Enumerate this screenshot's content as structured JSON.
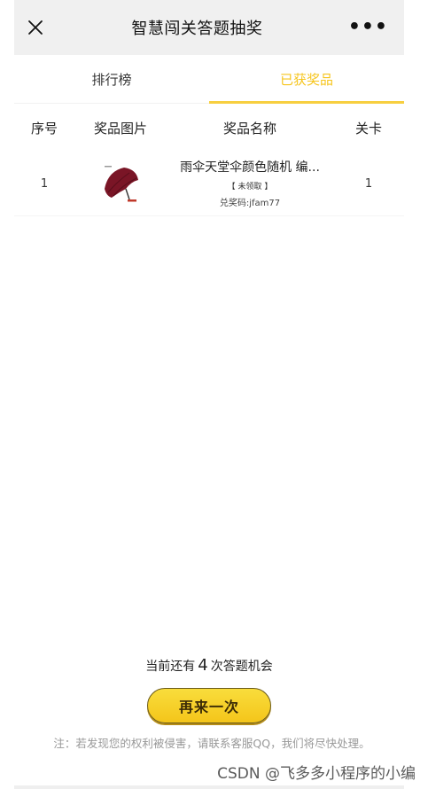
{
  "header": {
    "title": "智慧闯关答题抽奖",
    "more": "•••"
  },
  "tabs": [
    {
      "label": "排行榜",
      "active": false
    },
    {
      "label": "已获奖品",
      "active": true
    }
  ],
  "table": {
    "columns": [
      "序号",
      "奖品图片",
      "奖品名称",
      "关卡"
    ],
    "rows": [
      {
        "index": "1",
        "image": "umbrella-icon",
        "name": "雨伞天堂伞颜色随机 编...",
        "status": "【 未领取 】",
        "code": "兑奖码:jfam77",
        "level": "1"
      }
    ]
  },
  "footer": {
    "chances_prefix": "当前还有",
    "chances_count": "4",
    "chances_suffix": "次答题机会",
    "retry_label": "再来一次",
    "notice": "注：若发现您的权利被侵害，请联系客服QQ，我们将尽快处理。"
  },
  "watermark": "CSDN @飞多多小程序的小编",
  "colors": {
    "accent": "#f6c51d",
    "header_bg": "#f0f0f0",
    "umbrella": "#7a1526"
  }
}
